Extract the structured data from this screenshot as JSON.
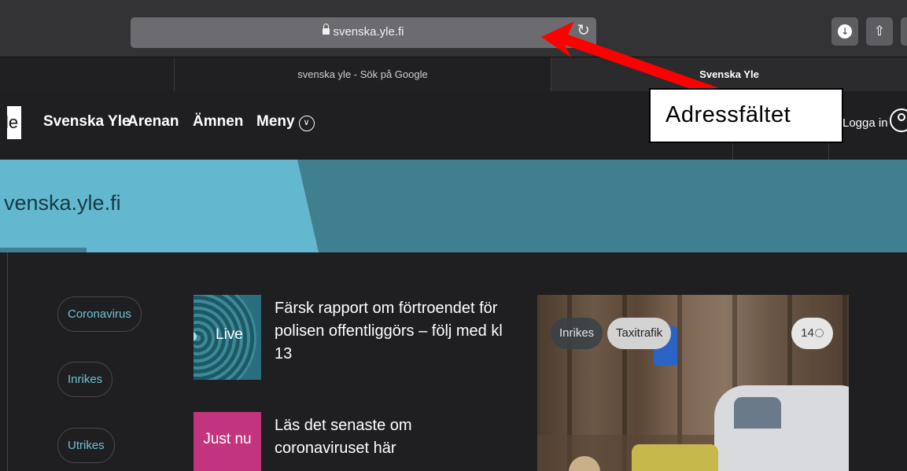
{
  "browser": {
    "url": "svenska.yle.fi",
    "tabs": [
      {
        "label": ""
      },
      {
        "label": "svenska yle - Sök på Google"
      },
      {
        "label": "Svenska Yle"
      }
    ]
  },
  "site": {
    "logo_text": "le",
    "nav": [
      {
        "label": "Svenska Yle"
      },
      {
        "label": "Arenan"
      },
      {
        "label": "Ämnen"
      },
      {
        "label": "Meny"
      }
    ],
    "login_label": "Logga in",
    "banner_title": "venska.yle.fi"
  },
  "sidebar": {
    "pills": [
      {
        "label": "Coronavirus"
      },
      {
        "label": "Inrikes"
      },
      {
        "label": "Utrikes"
      }
    ]
  },
  "news": [
    {
      "badge": "Live",
      "headline": "Färsk rapport om förtroendet för polisen offentliggörs – följ med kl 13"
    },
    {
      "badge": "Just nu",
      "headline": "Läs det senaste om coronaviruset här"
    }
  ],
  "featured": {
    "tags": [
      {
        "label": "Inrikes"
      },
      {
        "label": "Taxitrafik"
      }
    ],
    "comment_count": "14"
  },
  "annotation": {
    "label": "Adressfältet",
    "color": "#ff0000"
  }
}
